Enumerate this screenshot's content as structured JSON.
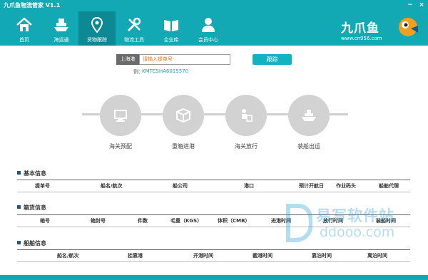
{
  "window": {
    "title": "九爪鱼物流管家 V1.1"
  },
  "nav": {
    "items": [
      {
        "label": "首页",
        "icon": "home-icon"
      },
      {
        "label": "海运通",
        "icon": "ship-icon"
      },
      {
        "label": "货物跟踪",
        "icon": "location-pin-icon",
        "active": true
      },
      {
        "label": "物流工具",
        "icon": "tools-icon"
      },
      {
        "label": "企业库",
        "icon": "book-icon"
      },
      {
        "label": "会员中心",
        "icon": "user-icon"
      }
    ],
    "brand_name": "九爪鱼",
    "brand_url": "www.cn956.com"
  },
  "search": {
    "port": "上海港",
    "placeholder": "请输入提单号",
    "button": "跟踪",
    "example_label": "例：",
    "example_value": "KMTCSHA6015570"
  },
  "steps": [
    {
      "label": "海关预配",
      "icon": "monitor-icon"
    },
    {
      "label": "重箱进港",
      "icon": "box-icon"
    },
    {
      "label": "海关放行",
      "icon": "customs-release-icon"
    },
    {
      "label": "装船出运",
      "icon": "ship-loading-icon"
    }
  ],
  "sections": {
    "basic": {
      "title": "基本信息",
      "columns": [
        "提单号",
        "船名/航次",
        "船公司",
        "港口",
        "预计开航日",
        "作业码头",
        "船舶代理"
      ]
    },
    "container": {
      "title": "箱货信息",
      "columns": [
        "箱号",
        "箱封号",
        "件数",
        "毛重（KGS）",
        "体积（CMB）",
        "进港时间",
        "放行时间",
        "装船时间"
      ]
    },
    "vessel": {
      "title": "船舶信息",
      "columns": [
        "船名/航次",
        "挂靠港",
        "开港时间",
        "截港时间",
        "靠泊时间",
        "离泊时间"
      ]
    }
  },
  "watermark": {
    "line1": "易写软件站",
    "line2": "ddooo.com"
  },
  "colors": {
    "primary": "#12a8b4",
    "active_nav": "#0d8994",
    "step_grey": "#d2d2d2",
    "link": "#12a8b4"
  }
}
